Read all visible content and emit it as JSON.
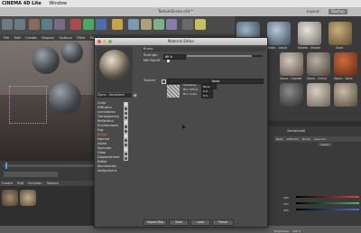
{
  "mac_menu": {
    "app_name": "CINEMA 4D Lite",
    "window_menu": "Window"
  },
  "window": {
    "title": "TextureScene.c4d *",
    "layout_label": "Layout:",
    "layout_value": "Startup"
  },
  "scene_menu": [
    "File",
    "Edit",
    "Create",
    "Display",
    "Options",
    "Filter",
    "Panel"
  ],
  "material_manager": {
    "menu": [
      "Create",
      "Edit",
      "Function",
      "Texture"
    ]
  },
  "material_editor": {
    "title": "Material Editor",
    "material_name": "Stone - Sandstone",
    "section": "Bump",
    "strength_label": "Strength",
    "strength_value": "86 %",
    "mip_falloff_label": "MIP Falloff",
    "texture_label": "Texture",
    "noise_label": "Noise",
    "sampling_label": "Sampling",
    "sampling_value": "None",
    "blur_offset_label": "Blur Offset",
    "blur_offset_value": "0 %",
    "blur_scale_label": "Blur Scale",
    "blur_scale_value": "0 %",
    "channels": [
      {
        "label": "Color",
        "checked": true
      },
      {
        "label": "Diffusion",
        "checked": false
      },
      {
        "label": "Luminance",
        "checked": false
      },
      {
        "label": "Transparency",
        "checked": false
      },
      {
        "label": "Reflection",
        "checked": true
      },
      {
        "label": "Environment",
        "checked": false
      },
      {
        "label": "Fog",
        "checked": false
      },
      {
        "label": "Bump",
        "checked": true
      },
      {
        "label": "Normal",
        "checked": false
      },
      {
        "label": "Alpha",
        "checked": false
      },
      {
        "label": "Specular",
        "checked": true
      },
      {
        "label": "Glow",
        "checked": false
      },
      {
        "label": "Displacement",
        "checked": false
      },
      {
        "label": "Editor",
        "checked": null
      },
      {
        "label": "Illumination",
        "checked": null
      },
      {
        "label": "Assignment",
        "checked": null
      }
    ],
    "bottom_buttons": [
      "Import Map",
      "Save",
      "Load",
      "Preset"
    ]
  },
  "right_panel": {
    "top_materials": [
      "Water",
      "Water - Liquid",
      "Marble - Simple",
      "Sand"
    ],
    "mid_materials": [
      "Stone - Granite",
      "Stone - Schist",
      "Stone - Sand"
    ],
    "attribute_tabs": [
      "Basic",
      "Diffusion",
      "Bump",
      "Specular"
    ],
    "material_label": "Sandstone8",
    "assign_tab": "Assign",
    "value_rows": [
      "255",
      "255",
      "255"
    ],
    "brightness_label": "Brightness",
    "brightness_value": "100 %"
  },
  "colors": {
    "accent": "#e88a2b",
    "dialog_bg": "#4a4a4a",
    "viewport_bg": "#6f6663"
  }
}
